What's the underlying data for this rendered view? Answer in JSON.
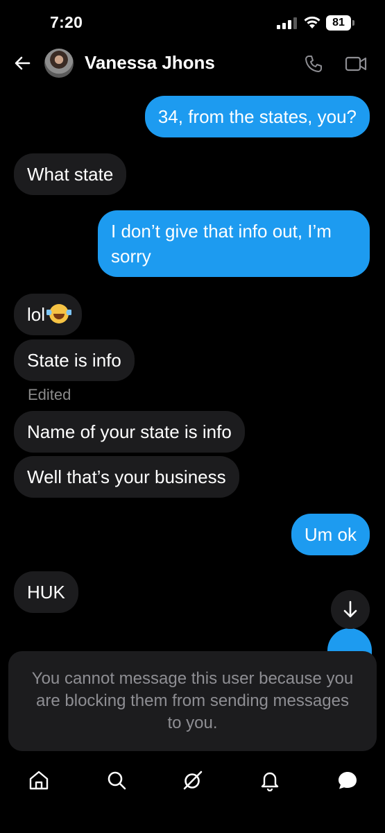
{
  "status_bar": {
    "time": "7:20",
    "battery": "81"
  },
  "header": {
    "contact_name": "Vanessa Jhons"
  },
  "messages": [
    {
      "side": "outgoing",
      "text": "34, from the states, you?"
    },
    {
      "side": "incoming",
      "text": "What state"
    },
    {
      "side": "outgoing",
      "text": "I don’t give that info out, I’m sorry"
    },
    {
      "side": "incoming",
      "text": "lol",
      "emoji": "face-with-tears-of-joy"
    },
    {
      "side": "incoming",
      "text": "State is info"
    },
    {
      "side": "incoming",
      "text": "Name of your state is info",
      "edited_label": "Edited"
    },
    {
      "side": "incoming",
      "text": "Well that’s your business"
    },
    {
      "side": "outgoing",
      "text": "Um ok"
    },
    {
      "side": "incoming",
      "text": "HUK"
    }
  ],
  "blocked_notice": "You cannot message this user because you are blocking them from sending messages to you.",
  "nav": [
    "home-icon",
    "search-icon",
    "grok-icon",
    "notifications-icon",
    "messages-icon"
  ],
  "colors": {
    "outgoing_bubble": "#1d9bf0",
    "incoming_bubble": "#1c1c1e",
    "background": "#000000"
  }
}
